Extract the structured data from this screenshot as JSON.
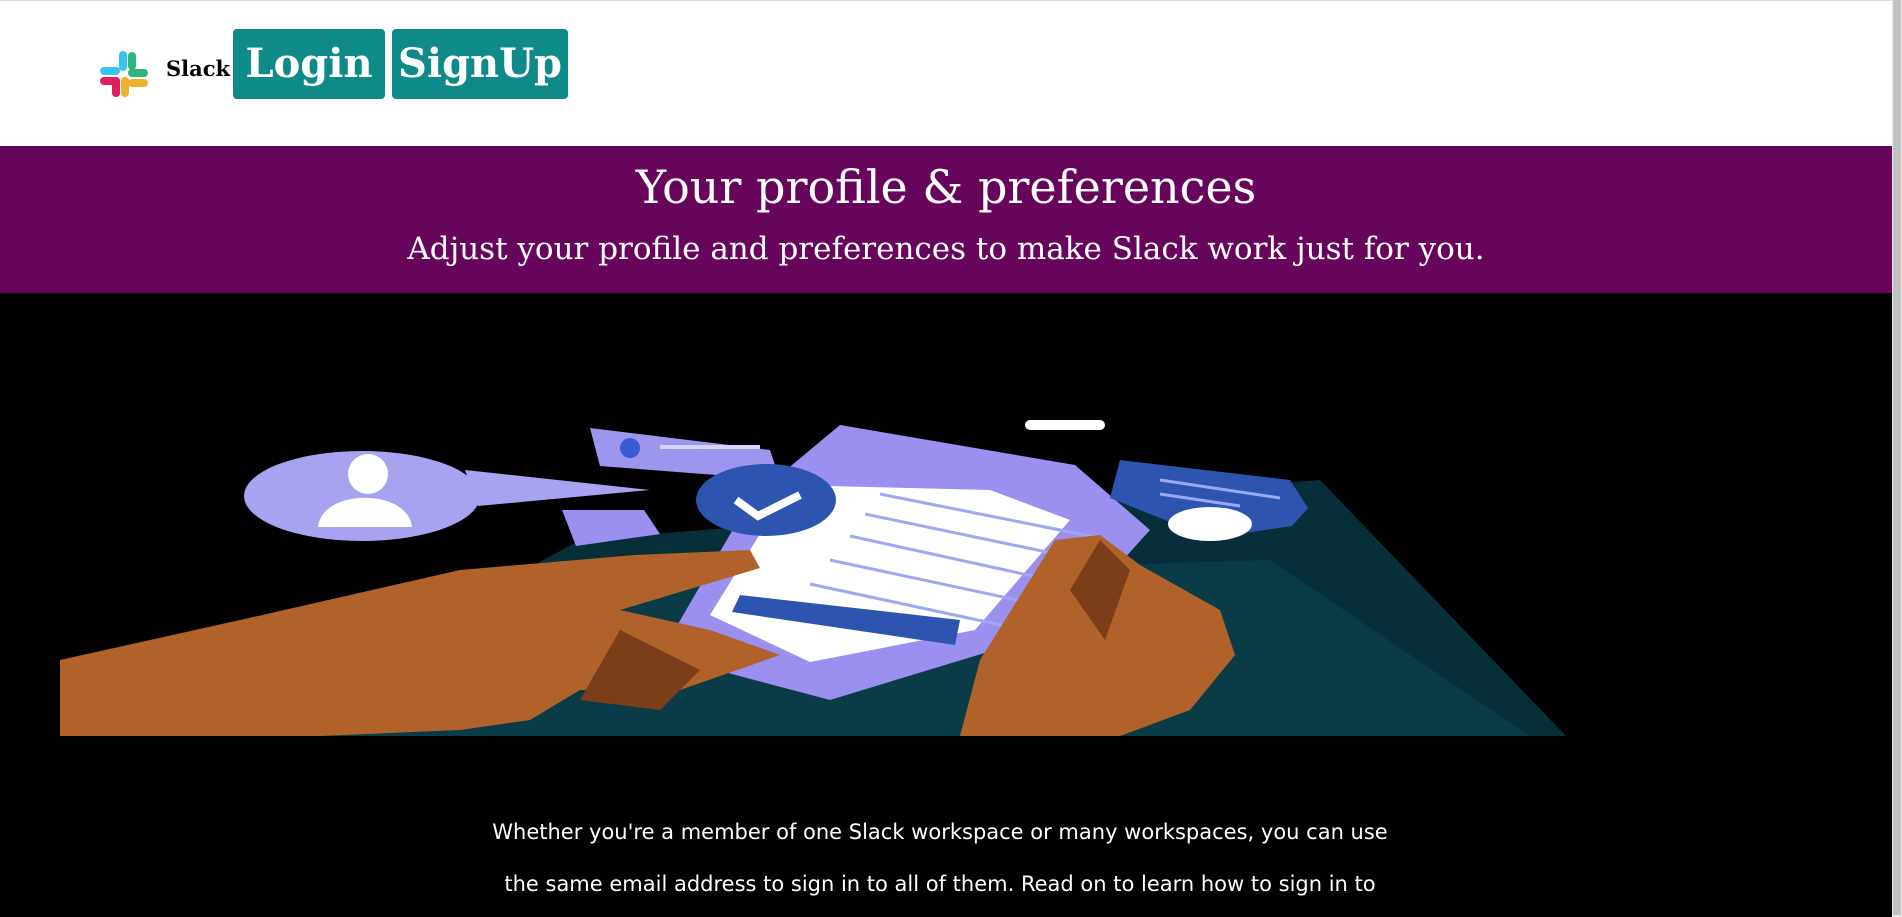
{
  "header": {
    "brand": "Slack",
    "login_label": "Login",
    "signup_label": "SignUp"
  },
  "banner": {
    "title": "Your profile & preferences",
    "subtitle": "Adjust your profile and preferences to make Slack work just for you."
  },
  "content": {
    "paragraph_line1": "Whether you're a member of one Slack workspace or many workspaces, you can use",
    "paragraph_line2": "the same email address to sign in to all of them. Read on to learn how to sign in to"
  },
  "colors": {
    "accent_teal": "#0e8a89",
    "banner_purple": "#67055d"
  }
}
